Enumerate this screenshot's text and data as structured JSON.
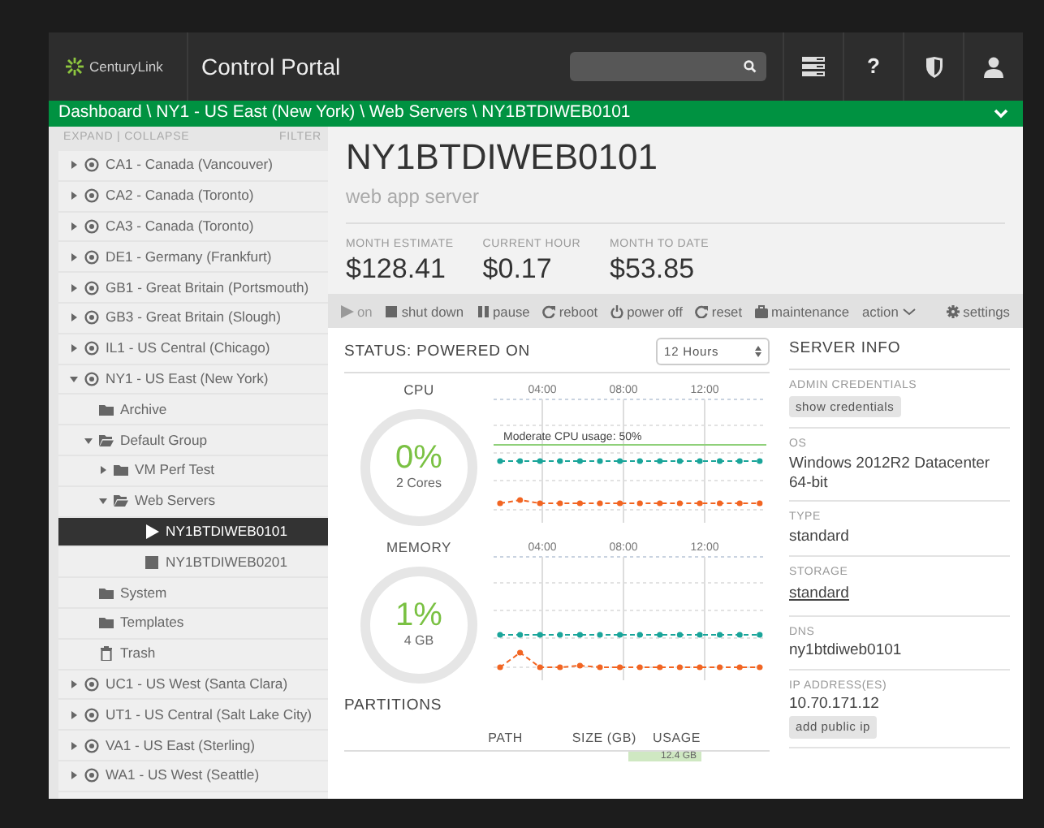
{
  "header": {
    "logo_text": "CenturyLink",
    "title": "Control Portal",
    "help_label": "?"
  },
  "breadcrumb": "Dashboard \\ NY1 - US East (New York) \\ Web Servers \\ NY1BTDIWEB0101",
  "sidebar": {
    "expand": "EXPAND",
    "separator": "|",
    "collapse": "COLLAPSE",
    "filter": "FILTER",
    "tree": [
      {
        "label": "CA1 - Canada (Vancouver)",
        "kind": "region",
        "expanded": false,
        "selected": false
      },
      {
        "label": "CA2 - Canada (Toronto)",
        "kind": "region",
        "expanded": false,
        "selected": false
      },
      {
        "label": "CA3 - Canada (Toronto)",
        "kind": "region",
        "expanded": false,
        "selected": false
      },
      {
        "label": "DE1 - Germany (Frankfurt)",
        "kind": "region",
        "expanded": false,
        "selected": false
      },
      {
        "label": "GB1 - Great Britain (Portsmouth)",
        "kind": "region",
        "expanded": false,
        "selected": false
      },
      {
        "label": "GB3 - Great Britain (Slough)",
        "kind": "region",
        "expanded": false,
        "selected": false
      },
      {
        "label": "IL1 - US Central (Chicago)",
        "kind": "region",
        "expanded": false,
        "selected": false
      },
      {
        "label": "NY1 - US East (New York)",
        "kind": "region",
        "expanded": true,
        "selected": false,
        "children": [
          {
            "label": "Archive",
            "kind": "folder",
            "selected": false
          },
          {
            "label": "Default Group",
            "kind": "folder",
            "expanded": true,
            "selected": false,
            "children": [
              {
                "label": "VM Perf Test",
                "kind": "folder",
                "expanded": false,
                "selected": false
              },
              {
                "label": "Web Servers",
                "kind": "folder",
                "expanded": true,
                "selected": false,
                "children": [
                  {
                    "label": "NY1BTDIWEB0101",
                    "kind": "server",
                    "running": true,
                    "selected": true
                  },
                  {
                    "label": "NY1BTDIWEB0201",
                    "kind": "server",
                    "running": false,
                    "selected": false
                  }
                ]
              }
            ]
          },
          {
            "label": "System",
            "kind": "folder",
            "selected": false
          },
          {
            "label": "Templates",
            "kind": "folder",
            "selected": false
          },
          {
            "label": "Trash",
            "kind": "trash",
            "selected": false
          }
        ]
      },
      {
        "label": "UC1 - US West (Santa Clara)",
        "kind": "region",
        "expanded": false,
        "selected": false
      },
      {
        "label": "UT1 - US Central (Salt Lake City)",
        "kind": "region",
        "expanded": false,
        "selected": false
      },
      {
        "label": "VA1 - US East (Sterling)",
        "kind": "region",
        "expanded": false,
        "selected": false
      },
      {
        "label": "WA1 - US West (Seattle)",
        "kind": "region",
        "expanded": false,
        "selected": false
      }
    ]
  },
  "server": {
    "name": "NY1BTDIWEB0101",
    "description": "web app server",
    "costs": [
      {
        "label": "MONTH ESTIMATE",
        "value": "$128.41"
      },
      {
        "label": "CURRENT HOUR",
        "value": "$0.17"
      },
      {
        "label": "MONTH TO DATE",
        "value": "$53.85"
      }
    ],
    "actions": [
      {
        "label": "on",
        "kind": "start",
        "disabled": true
      },
      {
        "label": "shut down",
        "kind": "shutdown",
        "disabled": false
      },
      {
        "label": "pause",
        "kind": "pause",
        "disabled": false
      },
      {
        "label": "reboot",
        "kind": "reboot",
        "disabled": false
      },
      {
        "label": "power off",
        "kind": "poweroff",
        "disabled": false
      },
      {
        "label": "reset",
        "kind": "reset",
        "disabled": false
      },
      {
        "label": "maintenance",
        "kind": "maintenance",
        "disabled": false
      },
      {
        "label": "action",
        "kind": "menu",
        "disabled": false
      },
      {
        "label": "settings",
        "kind": "settings",
        "disabled": false
      }
    ]
  },
  "status": {
    "title": "STATUS: POWERED ON",
    "range": "12 Hours",
    "metrics": [
      {
        "label": "CPU",
        "value": "0%",
        "detail": "2 Cores",
        "x_labels": [
          "04:00",
          "08:00",
          "12:00"
        ],
        "annotation": "Moderate CPU usage: 50%"
      },
      {
        "label": "MEMORY",
        "value": "1%",
        "detail": "4 GB",
        "x_labels": [
          "04:00",
          "08:00",
          "12:00"
        ]
      }
    ]
  },
  "partitions": {
    "title": "PARTITIONS",
    "columns": [
      "PATH",
      "SIZE (GB)",
      "USAGE"
    ],
    "rows": [
      {
        "usage": "12.4 GB"
      }
    ]
  },
  "server_info": {
    "title": "SERVER INFO",
    "fields": [
      {
        "label": "ADMIN CREDENTIALS",
        "kind": "button",
        "value": "show credentials"
      },
      {
        "label": "OS",
        "kind": "text",
        "value": "Windows 2012R2 Datacenter 64-bit"
      },
      {
        "label": "TYPE",
        "kind": "text",
        "value": "standard"
      },
      {
        "label": "STORAGE",
        "kind": "link",
        "value": "standard"
      },
      {
        "label": "DNS",
        "kind": "text",
        "value": "ny1btdiweb0101"
      },
      {
        "label": "IP ADDRESS(ES)",
        "kind": "text",
        "value": "10.70.171.12",
        "action": "add public ip"
      }
    ]
  }
}
